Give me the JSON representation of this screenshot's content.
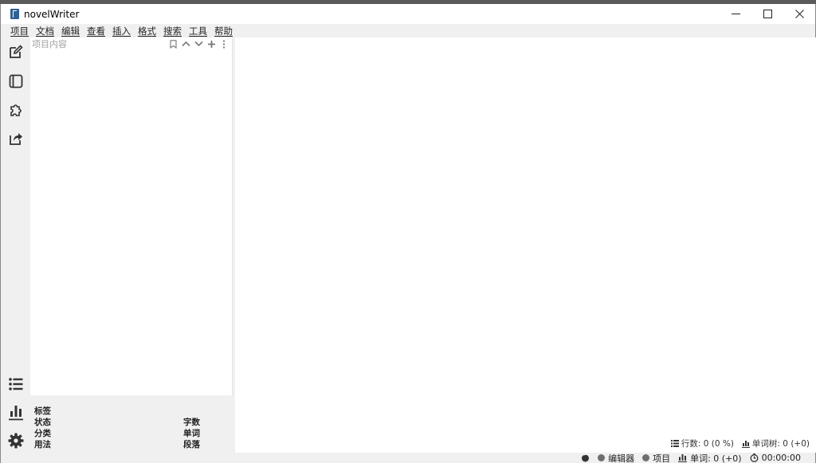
{
  "window": {
    "title": "novelWriter",
    "controls": {
      "minimize": "–",
      "maximize": "☐",
      "close": "✕"
    }
  },
  "menu": {
    "items": [
      "项目",
      "文档",
      "编辑",
      "查看",
      "插入",
      "格式",
      "搜索",
      "工具",
      "帮助"
    ]
  },
  "sidebar": {
    "top_icons": [
      "edit-icon",
      "book-icon",
      "puzzle-icon",
      "export-icon"
    ],
    "bottom_icons": [
      "list-icon",
      "stats-icon",
      "settings-icon"
    ]
  },
  "tree": {
    "title": "项目内容",
    "tools": [
      "bookmark-icon",
      "chevron-up-icon",
      "chevron-down-icon",
      "plus-icon",
      "more-icon"
    ]
  },
  "details": {
    "tag_label": "标签",
    "status_label": "状态",
    "class_label": "分类",
    "usage_label": "用法",
    "chars_label": "字数",
    "words_label": "单词",
    "paragraphs_label": "段落"
  },
  "editor_footer": {
    "lines": "行数: 0 (0 %)",
    "words": "单词树: 0 (+0)"
  },
  "status": {
    "editor_label": "编辑器",
    "project_label": "项目",
    "words": "单词: 0 (+0)",
    "timer": "00:00:00"
  },
  "colors": {
    "accent": "#2f5f93",
    "panel": "#f0f0f0",
    "editor_bg": "#ffffff",
    "status_dot": "#6e6e6e"
  }
}
